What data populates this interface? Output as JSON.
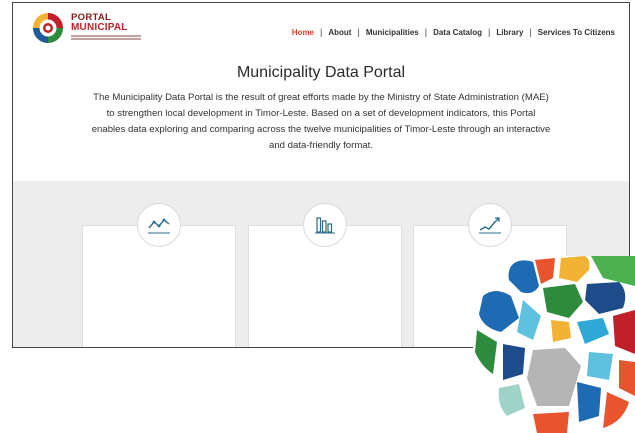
{
  "logo": {
    "line1": "PORTAL",
    "line2": "MUNICIPAL"
  },
  "nav": {
    "items": [
      {
        "label": "Home",
        "active": true
      },
      {
        "label": "About"
      },
      {
        "label": "Municipalities"
      },
      {
        "label": "Data Catalog"
      },
      {
        "label": "Library"
      },
      {
        "label": "Services To Citizens"
      }
    ]
  },
  "intro": {
    "title": "Municipality Data Portal",
    "body": "The Municipality Data Portal is the result of great efforts made by the Ministry of State Administration (MAE) to strengthen local development in Timor-Leste. Based on a set of development indicators, this Portal enables data exploring and comparing across the twelve municipalities of Timor-Leste through an interactive and data-friendly format."
  },
  "cards": [
    {
      "icon": "line-chart-icon"
    },
    {
      "icon": "bar-chart-icon"
    },
    {
      "icon": "trend-chart-icon"
    }
  ],
  "colors": {
    "accent": "#d0482a",
    "brand_red": "#c0202a",
    "gray_band": "#ededed"
  }
}
